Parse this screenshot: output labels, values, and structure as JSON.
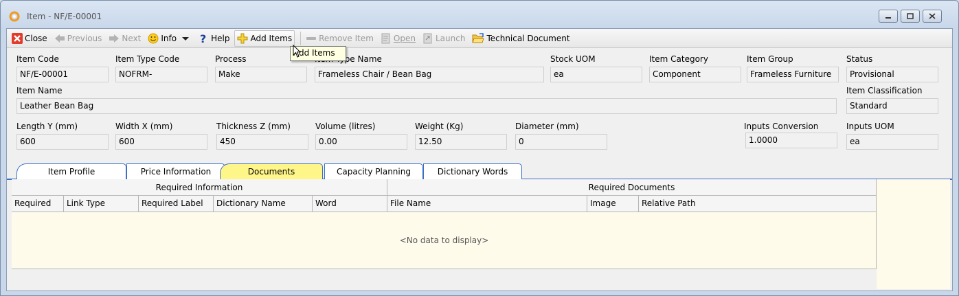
{
  "window": {
    "title": "Item - NF/E-00001"
  },
  "toolbar": {
    "close": "Close",
    "previous": "Previous",
    "next": "Next",
    "info": "Info",
    "help": "Help",
    "add_items": "Add Items",
    "remove_item": "Remove Item",
    "open": "Open",
    "launch": "Launch",
    "technical_document": "Technical Document"
  },
  "tooltip": "Add Items",
  "fields": {
    "item_code": {
      "label": "Item Code",
      "value": "NF/E-00001"
    },
    "item_type_code": {
      "label": "Item Type Code",
      "value": "NOFRM-"
    },
    "process": {
      "label": "Process",
      "value": "Make"
    },
    "item_type_name": {
      "label": "Item Type Name",
      "value": "Frameless Chair / Bean Bag"
    },
    "stock_uom": {
      "label": "Stock UOM",
      "value": "ea"
    },
    "item_category": {
      "label": "Item Category",
      "value": "Component"
    },
    "item_group": {
      "label": "Item Group",
      "value": "Frameless Furniture"
    },
    "status": {
      "label": "Status",
      "value": "Provisional"
    },
    "item_name": {
      "label": "Item Name",
      "value": "Leather Bean Bag"
    },
    "item_classification": {
      "label": "Item Classification",
      "value": "Standard"
    },
    "length_y": {
      "label": "Length Y (mm)",
      "value": "600"
    },
    "width_x": {
      "label": "Width X (mm)",
      "value": "600"
    },
    "thickness_z": {
      "label": "Thickness Z (mm)",
      "value": "450"
    },
    "volume": {
      "label": "Volume (litres)",
      "value": "0.00"
    },
    "weight": {
      "label": "Weight (Kg)",
      "value": "12.50"
    },
    "diameter": {
      "label": "Diameter (mm)",
      "value": "0"
    },
    "inputs_conversion": {
      "label": "Inputs Conversion",
      "value": "1.0000"
    },
    "inputs_uom": {
      "label": "Inputs UOM",
      "value": "ea"
    }
  },
  "tabs": [
    "Item Profile",
    "Price Information",
    "Documents",
    "Capacity Planning",
    "Dictionary Words"
  ],
  "active_tab": "Documents",
  "grid": {
    "bands": [
      "Required Information",
      "Required Documents"
    ],
    "columns": [
      "Required",
      "Link Type",
      "Required Label",
      "Dictionary Name",
      "Word",
      "File Name",
      "Image",
      "Relative Path"
    ],
    "empty_text": "<No data to display>"
  }
}
